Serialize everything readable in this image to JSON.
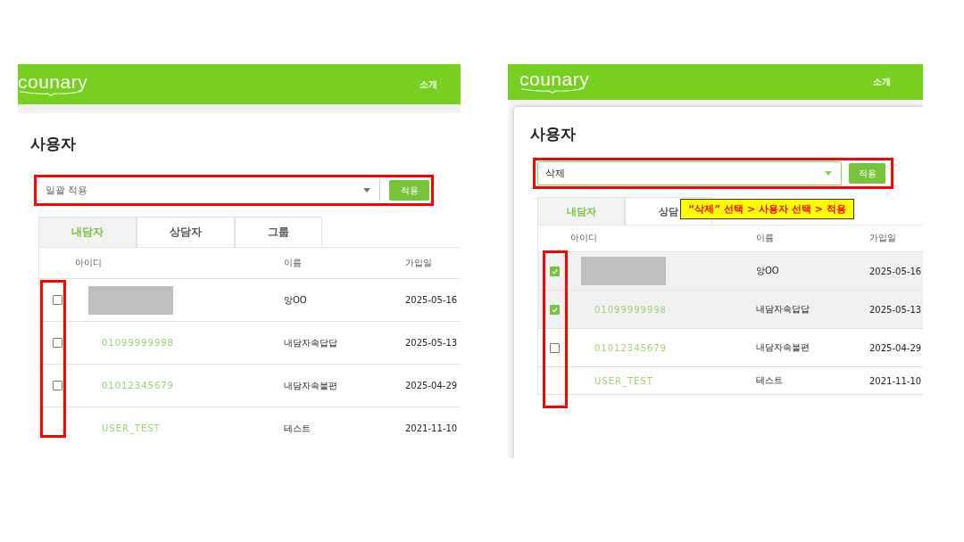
{
  "screens": [
    {
      "kind": "plain",
      "header": {
        "logo": "counary",
        "nav": "소개"
      },
      "title": "사용자",
      "bulk": {
        "placeholder": "일괄 적용",
        "button": "적용"
      },
      "tabs": [
        {
          "label": "내담자",
          "selected": true
        },
        {
          "label": "상담자",
          "selected": false
        },
        {
          "label": "그룹",
          "selected": false
        }
      ],
      "table": {
        "columns": [
          "아이디",
          "이름",
          "가입일"
        ],
        "rows": [
          {
            "id_redacted": true,
            "name": "앙OO",
            "date": "2025-05-16",
            "checked": false,
            "selected": false
          },
          {
            "id": "01099999998",
            "name": "내담자속답답",
            "date": "2025-05-13",
            "checked": false,
            "selected": false
          },
          {
            "id": "01012345679",
            "name": "내담자속불편",
            "date": "2025-04-29",
            "checked": false,
            "selected": false
          },
          {
            "id": "USER_TEST",
            "name": "테스트",
            "date": "2021-11-10",
            "selected": false
          }
        ]
      }
    },
    {
      "kind": "card",
      "header": {
        "logo": "counary",
        "nav": "소개"
      },
      "title": "사용자",
      "bulk": {
        "value": "삭제",
        "button": "적용"
      },
      "tabs": [
        {
          "label": "내담자",
          "selected": true
        },
        {
          "label": "상담",
          "selected": false
        }
      ],
      "callout": "“삭제” 선택 > 사용자 선택 > 적용",
      "table": {
        "columns": [
          "아이디",
          "이름",
          "가입일"
        ],
        "rows": [
          {
            "id_redacted": true,
            "name": "앙OO",
            "date": "2025-05-16",
            "checked": true,
            "selected": true
          },
          {
            "id": "01099999998",
            "name": "내담자속답답",
            "date": "2025-05-13",
            "checked": true,
            "selected": true
          },
          {
            "id": "01012345679",
            "name": "내담자속불편",
            "date": "2025-04-29",
            "checked": false,
            "selected": false
          },
          {
            "id": "USER_TEST",
            "name": "테스트",
            "date": "2021-11-10",
            "selected": false
          }
        ]
      }
    }
  ]
}
